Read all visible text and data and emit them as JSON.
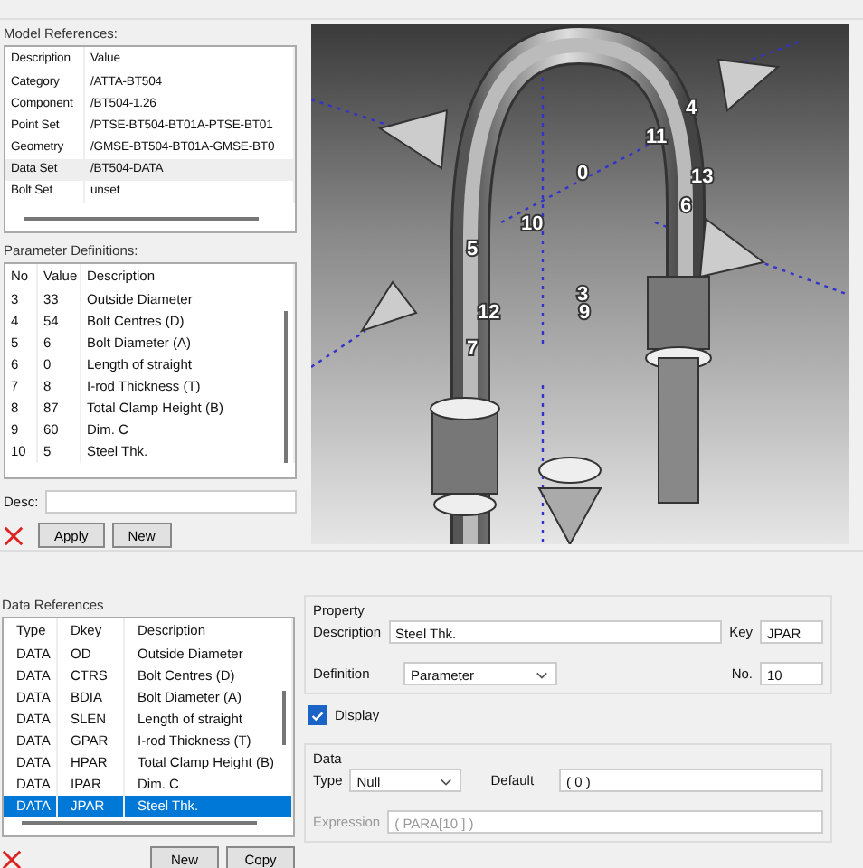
{
  "model_references": {
    "label": "Model References:",
    "columns": [
      "Description",
      "Value"
    ],
    "rows": [
      {
        "description": "Category",
        "value": "/ATTA-BT504",
        "selected": false
      },
      {
        "description": "Component",
        "value": "/BT504-1.26",
        "selected": false
      },
      {
        "description": "Point Set",
        "value": "/PTSE-BT504-BT01A-PTSE-BT01",
        "selected": false
      },
      {
        "description": "Geometry",
        "value": "/GMSE-BT504-BT01A-GMSE-BT0",
        "selected": false
      },
      {
        "description": "Data Set",
        "value": "/BT504-DATA",
        "selected": true
      },
      {
        "description": "Bolt Set",
        "value": "unset",
        "selected": false
      }
    ]
  },
  "parameter_definitions": {
    "label": "Parameter Definitions:",
    "columns": [
      "No",
      "Value",
      "Description"
    ],
    "rows": [
      {
        "no": "3",
        "value": "33",
        "description": "Outside Diameter"
      },
      {
        "no": "4",
        "value": "54",
        "description": "Bolt Centres (D)"
      },
      {
        "no": "5",
        "value": "6",
        "description": "Bolt Diameter (A)"
      },
      {
        "no": "6",
        "value": "0",
        "description": "Length of straight"
      },
      {
        "no": "7",
        "value": "8",
        "description": "I-rod Thickness (T)"
      },
      {
        "no": "8",
        "value": "87",
        "description": "Total Clamp Height (B)"
      },
      {
        "no": "9",
        "value": "60",
        "description": "Dim. C"
      },
      {
        "no": "10",
        "value": "5",
        "description": "Steel Thk."
      }
    ]
  },
  "desc": {
    "label": "Desc:"
  },
  "param_buttons": [
    "Apply",
    "New"
  ],
  "viewport": {
    "labels": [
      "4",
      "11",
      "0",
      "13",
      "6",
      "10",
      "5",
      "3",
      "12",
      "9",
      "7"
    ]
  },
  "data_references": {
    "label": "Data References",
    "columns": [
      "Type",
      "Dkey",
      "Description"
    ],
    "rows": [
      {
        "type": "DATA",
        "dkey": "OD",
        "description": "Outside Diameter",
        "selected": false
      },
      {
        "type": "DATA",
        "dkey": "CTRS",
        "description": "Bolt Centres (D)",
        "selected": false
      },
      {
        "type": "DATA",
        "dkey": "BDIA",
        "description": "Bolt Diameter (A)",
        "selected": false
      },
      {
        "type": "DATA",
        "dkey": "SLEN",
        "description": "Length of straight",
        "selected": false
      },
      {
        "type": "DATA",
        "dkey": "GPAR",
        "description": "I-rod Thickness (T)",
        "selected": false
      },
      {
        "type": "DATA",
        "dkey": "HPAR",
        "description": "Total Clamp Height (B)",
        "selected": false
      },
      {
        "type": "DATA",
        "dkey": "IPAR",
        "description": "Dim. C",
        "selected": false
      },
      {
        "type": "DATA",
        "dkey": "JPAR",
        "description": "Steel Thk.",
        "selected": true
      }
    ]
  },
  "data_buttons": [
    "New",
    "Copy"
  ],
  "property": {
    "title": "Property",
    "description_label": "Description",
    "description_value": "Steel Thk.",
    "key_label": "Key",
    "key_value": "JPAR",
    "definition_label": "Definition",
    "definition_value": "Parameter",
    "no_label": "No.",
    "no_value": "10"
  },
  "display": {
    "label": "Display",
    "checked": true
  },
  "data": {
    "title": "Data",
    "type_label": "Type",
    "type_value": "Null",
    "default_label": "Default",
    "default_value": "( 0 )",
    "expression_label": "Expression",
    "expression_value": "( PARA[10 ] )",
    "expression_disabled": true
  }
}
